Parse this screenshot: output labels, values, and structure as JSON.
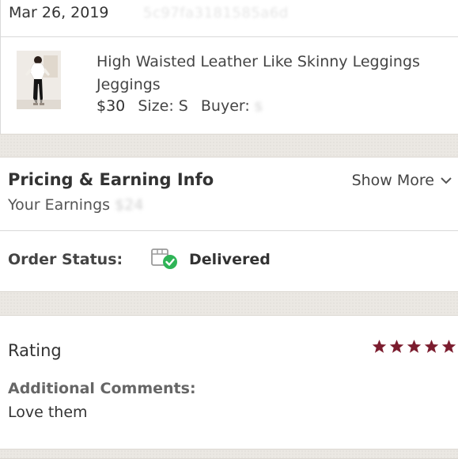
{
  "order": {
    "date": "Mar 26, 2019",
    "order_id": "5c97fa3181585a6d"
  },
  "item": {
    "thumbnail_icon": "product-photo",
    "title": "High Waisted Leather Like Skinny Leggings Jeggings",
    "price": "$30",
    "size": "Size: S",
    "buyer_label": "Buyer:",
    "buyer_value": "s"
  },
  "pricing": {
    "title": "Pricing & Earning Info",
    "show_more": "Show More",
    "earnings_label": "Your Earnings",
    "earnings_value": "$24"
  },
  "status": {
    "label": "Order Status:",
    "value": "Delivered",
    "icon": "package-delivered-icon",
    "check_color": "#2fb457"
  },
  "rating": {
    "title": "Rating",
    "stars": 5,
    "star_color": "#7b1c2e",
    "comments_label": "Additional Comments:",
    "comments_value": "Love them"
  },
  "colors": {
    "background_gap": "#ebe8e3",
    "divider": "#d9d9d9"
  }
}
